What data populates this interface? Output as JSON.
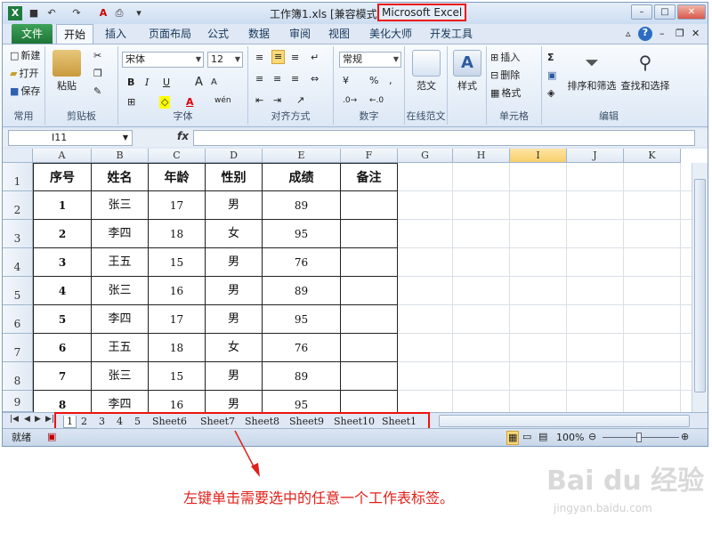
{
  "window": {
    "file_title": "工作簿1.xls  [兼容模式]  -",
    "app_title": "Microsoft Excel",
    "logo": "X",
    "min_label": "–",
    "max_label": "□",
    "close_label": "✕"
  },
  "quick_access": [
    "save-icon",
    "undo-icon",
    "redo-icon",
    "font-color-icon",
    "print-preview-icon",
    "customize-icon"
  ],
  "ribbon_tabs": {
    "file": "文件",
    "tabs": [
      "开始",
      "插入",
      "页面布局",
      "公式",
      "数据",
      "审阅",
      "视图",
      "美化大师",
      "开发工具"
    ],
    "active": "开始"
  },
  "ribbon": {
    "common": {
      "new": "新建",
      "open": "打开",
      "save": "保存",
      "label": "常用"
    },
    "clipboard": {
      "paste": "粘贴",
      "label": "剪贴板"
    },
    "font": {
      "name": "宋体",
      "size": "12",
      "bold": "B",
      "italic": "I",
      "underline": "U",
      "grow": "A",
      "shrink": "A",
      "wen": "wén",
      "label": "字体"
    },
    "alignment": {
      "label": "对齐方式"
    },
    "number": {
      "format": "常规",
      "percent": "%",
      "comma": ",",
      "label": "数字"
    },
    "online": {
      "button": "范文",
      "label": "在线范文"
    },
    "styles": {
      "button": "样式"
    },
    "cells": {
      "insert": "插入",
      "delete": "删除",
      "format": "格式",
      "label": "单元格"
    },
    "editing": {
      "sigma": "Σ",
      "sort": "排序和筛选",
      "find": "查找和选择",
      "label": "编辑"
    }
  },
  "formula_bar": {
    "name_box": "I11",
    "fx": "fx",
    "value": ""
  },
  "columns": [
    "A",
    "B",
    "C",
    "D",
    "E",
    "F",
    "G",
    "H",
    "I",
    "J",
    "K"
  ],
  "selected_column": "I",
  "rows": [
    "1",
    "2",
    "3",
    "4",
    "5",
    "6",
    "7",
    "8",
    "9"
  ],
  "table": {
    "headers": [
      "序号",
      "姓名",
      "年龄",
      "性别",
      "成绩",
      "备注"
    ],
    "data": [
      [
        "1",
        "张三",
        "17",
        "男",
        "89",
        ""
      ],
      [
        "2",
        "李四",
        "18",
        "女",
        "95",
        ""
      ],
      [
        "3",
        "王五",
        "15",
        "男",
        "76",
        ""
      ],
      [
        "4",
        "张三",
        "16",
        "男",
        "89",
        ""
      ],
      [
        "5",
        "李四",
        "17",
        "男",
        "95",
        ""
      ],
      [
        "6",
        "王五",
        "18",
        "女",
        "76",
        ""
      ],
      [
        "7",
        "张三",
        "15",
        "男",
        "89",
        ""
      ],
      [
        "8",
        "李四",
        "16",
        "男",
        "95",
        ""
      ]
    ]
  },
  "sheet_tabs": [
    "1",
    "2",
    "3",
    "4",
    "5",
    "Sheet6",
    "Sheet7",
    "Sheet8",
    "Sheet9",
    "Sheet10",
    "Sheet1"
  ],
  "active_sheet": "1",
  "status": {
    "ready": "就绪",
    "zoom": "100%"
  },
  "caption": "左键单击需要选中的任意一个工作表标签。",
  "watermark": {
    "logo": "Bai du 经验",
    "url": "jingyan.baidu.com"
  },
  "colors": {
    "accent_red": "#e11",
    "excel_green": "#1f7a3e",
    "caption": "#e0201a"
  }
}
